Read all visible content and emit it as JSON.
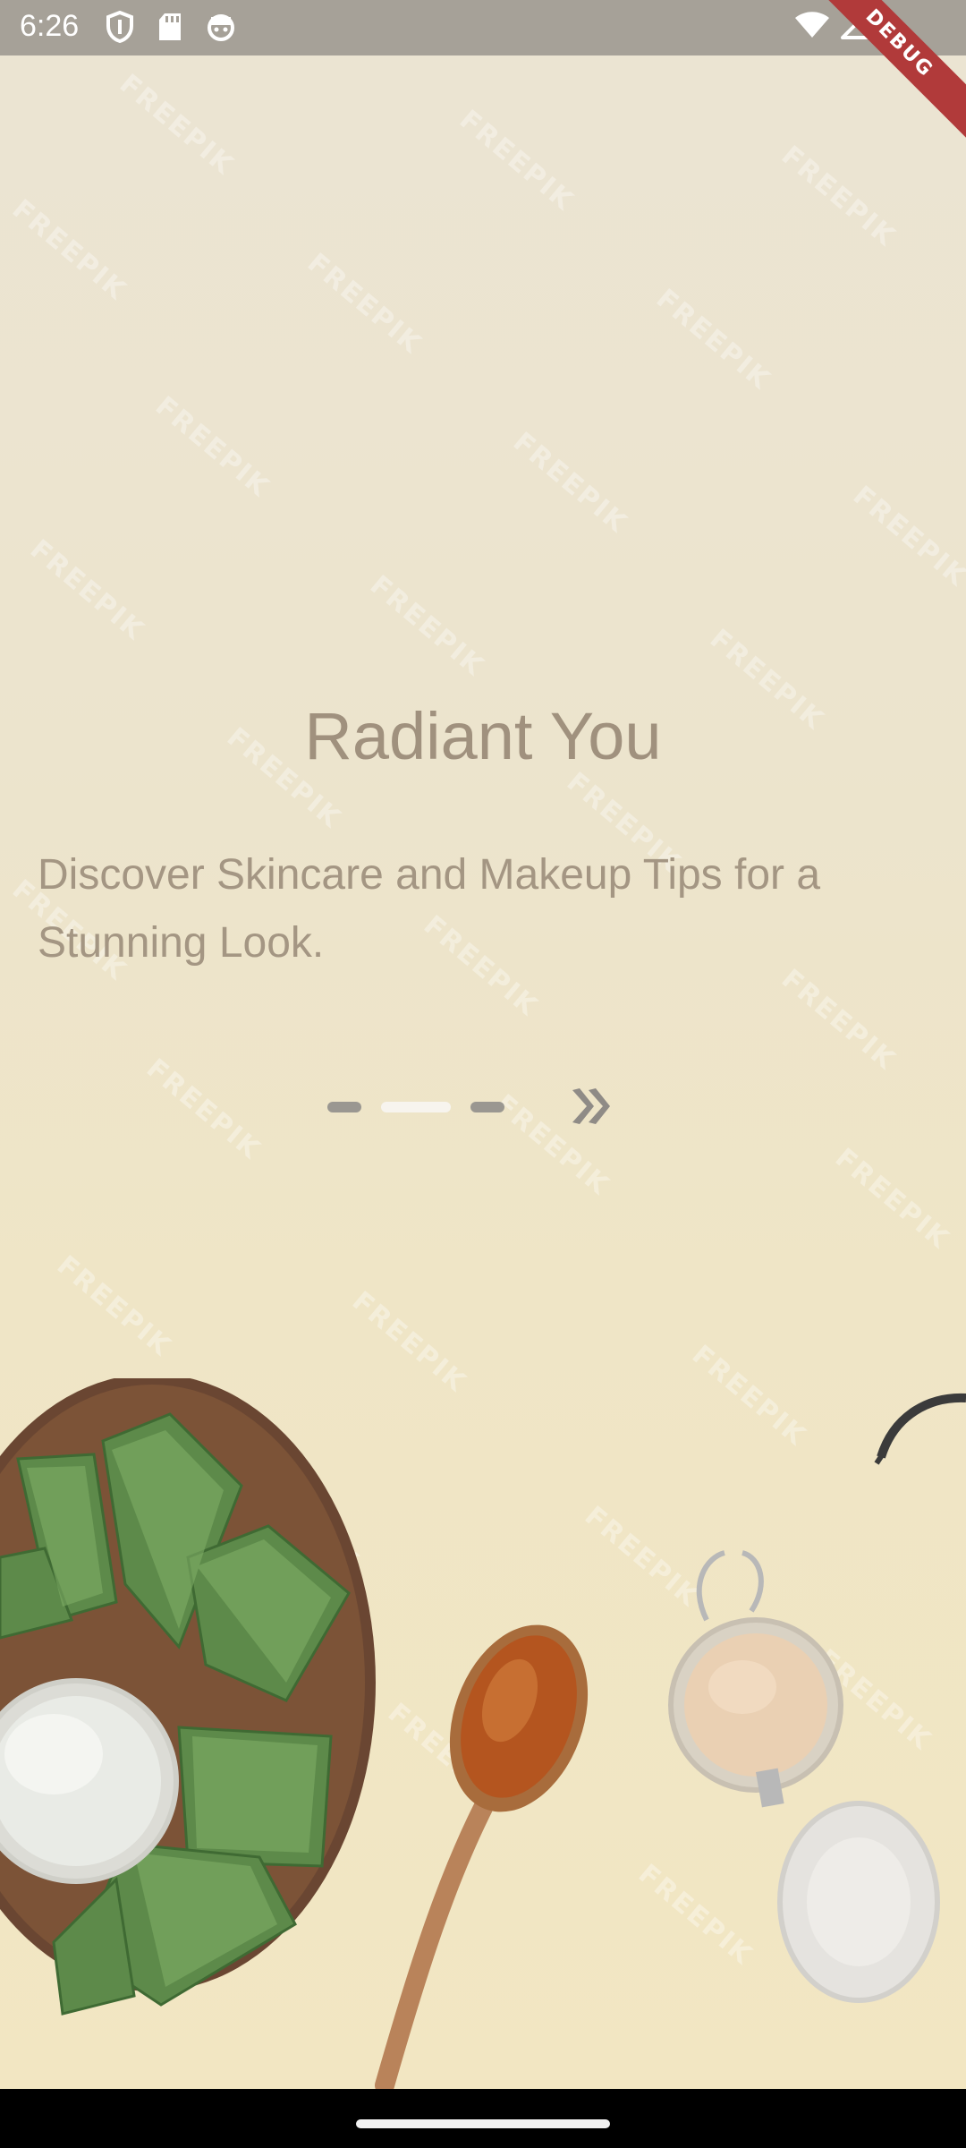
{
  "status_bar": {
    "time": "6:26",
    "left_icons": [
      "shield-icon",
      "sd-card-icon",
      "android-face-icon"
    ],
    "right_icons": [
      "wifi-icon",
      "cellular-signal-icon"
    ],
    "debug_label": "DEBUG"
  },
  "onboarding": {
    "title": "Radiant You",
    "subtitle": "Discover Skincare and Makeup Tips for a Stunning Look.",
    "page_count": 3,
    "active_page": 2
  },
  "watermark_text": "FREEPIK",
  "colors": {
    "background": "#ece4cf",
    "title": "#a0917e",
    "indicator_inactive": "#9a9791",
    "indicator_active": "#f7f4ee",
    "debug_banner": "#b13a3a"
  }
}
